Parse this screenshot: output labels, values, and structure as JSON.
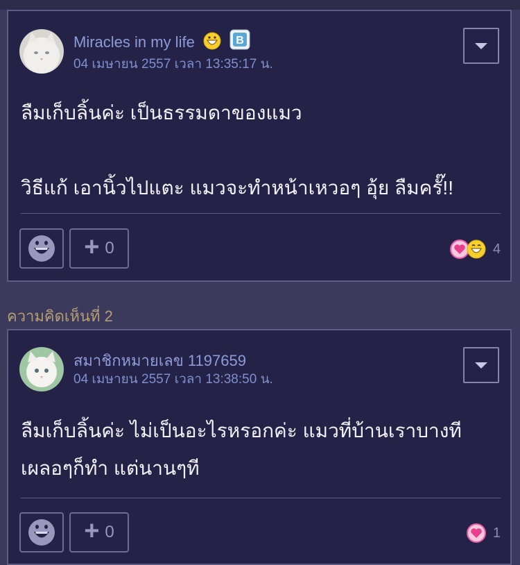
{
  "comments": [
    {
      "username": "Miracles in my life",
      "timestamp": "04 เมษายน 2557 เวลา 13:35:17 น.",
      "body_lines": [
        "ลืมเก็บลิ้นค่ะ เป็นธรรมดาของแมว",
        "",
        "วิธีแก้ เอานิ้วไปแตะ แมวจะทำหน้าเหวอๆ อุ้ย ลืมครั๊!!"
      ],
      "plus_count": "0",
      "reaction_count": "4",
      "reaction_icons": [
        "heart-icon",
        "grin-icon"
      ],
      "badges": [
        "grin-emoji-icon",
        "blogger-badge-icon"
      ]
    },
    {
      "username": "สมาชิกหมายเลข 1197659",
      "timestamp": "04 เมษายน 2557 เวลา 13:38:50 น.",
      "body_lines": [
        "ลืมเก็บลิ้นค่ะ ไม่เป็นอะไรหรอกค่ะ แมวที่บ้านเราบางที",
        "เผลอๆก็ทำ แต่นานๆที"
      ],
      "plus_count": "0",
      "reaction_count": "1",
      "reaction_icons": [
        "heart-icon"
      ]
    }
  ],
  "section": {
    "comment2_label": "ความคิดเห็นที่ 2"
  },
  "icons": {
    "menu": "dropdown-arrow-icon",
    "emoji_button": "smiley-icon",
    "plus": "plus-icon"
  },
  "colors": {
    "background": "#3c3a5c",
    "card": "#242246",
    "username": "#8e9bd9",
    "label": "#b69d74",
    "heart": "#e85aa4"
  }
}
